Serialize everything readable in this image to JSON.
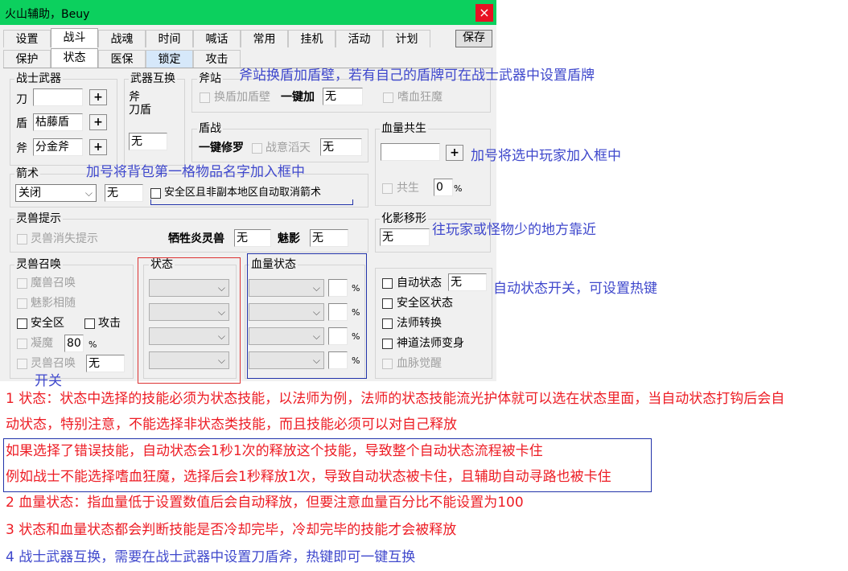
{
  "window": {
    "title": "火山辅助，Beuy",
    "close_glyph": "×",
    "save_label": "保存",
    "accent_color": "#0cd05e"
  },
  "tabs_row1": [
    "设置",
    "战斗",
    "战魂",
    "时间",
    "喊话",
    "常用",
    "挂机",
    "活动",
    "计划"
  ],
  "tabs_row2": [
    "保护",
    "状态",
    "医保",
    "锁定",
    "攻击"
  ],
  "warrior_weapon": {
    "title": "战士武器",
    "blade_label": "刀",
    "blade_value": "",
    "shield_label": "盾",
    "shield_value": "枯藤盾",
    "axe_label": "斧",
    "axe_value": "分金斧",
    "plus": "+"
  },
  "weapon_swap": {
    "title": "武器互换",
    "line1": "斧",
    "line2": "刀盾",
    "value": "无"
  },
  "axe_stance": {
    "title": "斧站",
    "swap_shield": "换盾加盾壁",
    "one_key": "一键加",
    "value": "无",
    "bloodlust": "嗜血狂魔"
  },
  "shield_combat": {
    "title": "盾战",
    "one_key": "一键修罗",
    "battle_intent": "战意滔天",
    "value": "无"
  },
  "blood_share": {
    "title": "血量共生",
    "value": "",
    "plus": "+",
    "share_label": "共生",
    "share_value": "0"
  },
  "arrow": {
    "title": "箭术",
    "select_value": "关闭",
    "value": "无",
    "safe_zone_label": "安全区且非副本地区自动取消箭术"
  },
  "spirit_hint": {
    "title": "灵兽提示",
    "vanish": "灵兽消失提示",
    "sacrifice_label": "牺牲炎灵兽",
    "sacrifice_value": "无",
    "shadow_label": "魅影",
    "shadow_value": "无"
  },
  "transform": {
    "title": "化影移形",
    "value": "无"
  },
  "spirit_summon": {
    "title": "灵兽召唤",
    "demon": "魔兽召唤",
    "shadow_follow": "魅影相随",
    "safe": "安全区",
    "attack": "攻击",
    "condense": "凝魔",
    "condense_value": "80",
    "pct": "%",
    "summon": "灵兽召唤",
    "summon_value": "无"
  },
  "status": {
    "title": "状态"
  },
  "hp_status": {
    "title": "血量状态",
    "pct": "%"
  },
  "auto_status": {
    "auto_label": "自动状态",
    "auto_value": "无",
    "safe_zone": "安全区状态",
    "mage_switch": "法师转换",
    "shendao": "神道法师变身",
    "blood_vein": "血脉觉醒"
  },
  "annotations": {
    "a1": "斧站换盾加盾壁，若有自己的盾牌可在战士武器中设置盾牌",
    "a2": "加号将选中玩家加入框中",
    "a3": "加号将背包第一格物品名字加入框中",
    "a4": "往玩家或怪物少的地方靠近",
    "a5": "自动状态开关，可设置热键",
    "a6": "开关"
  },
  "notes": {
    "n1a": "1 状态：状态中选择的技能必须为状态技能，以法师为例，法师的状态技能流光护体就可以选在状态里面，当自动状态打钩后会自",
    "n1b": "动状态，特别注意，不能选择非状态类技能，而且技能必须可以对自己释放",
    "n2a": "如果选择了错误技能，自动状态会1秒1次的释放这个技能，导致整个自动状态流程被卡住",
    "n2b": "例如战士不能选择嗜血狂魔，选择后会1秒释放1次，导致自动状态被卡住，且辅助自动寻路也被卡住",
    "n3": "2 血量状态：指血量低于设置数值后会自动释放，但要注意血量百分比不能设置为100",
    "n4": "3 状态和血量状态都会判断技能是否冷却完毕，冷却完毕的技能才会被释放",
    "n5": "4 战士武器互换，需要在战士武器中设置刀盾斧，热键即可一键互换"
  },
  "colors": {
    "annotation_blue": "#3f48cc",
    "note_red": "#ed1c24"
  }
}
